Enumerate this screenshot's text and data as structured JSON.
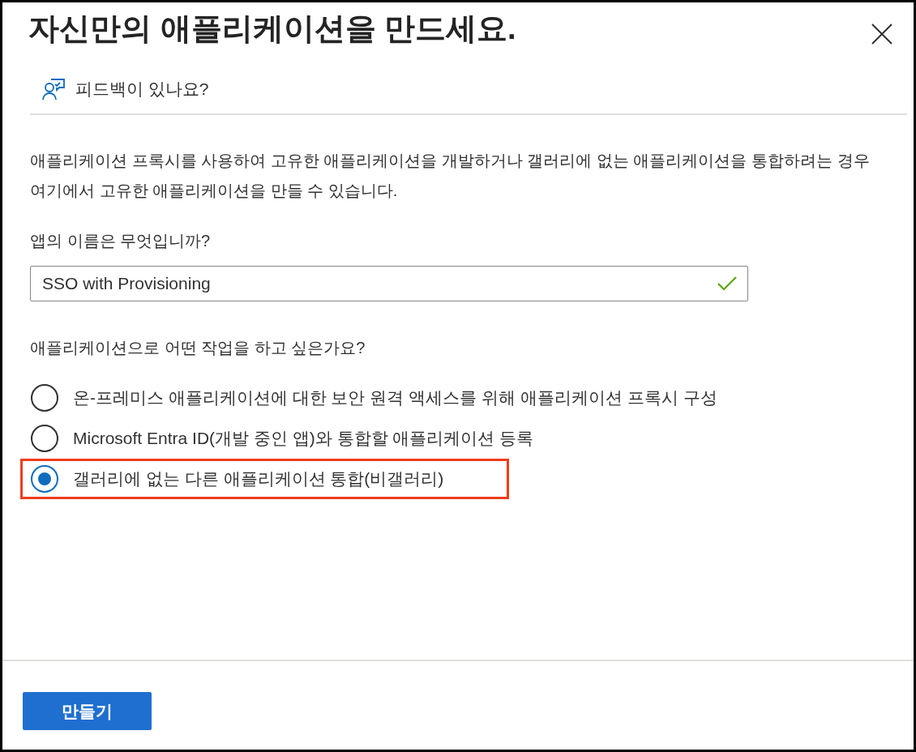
{
  "title": "자신만의 애플리케이션을 만드세요.",
  "feedback": {
    "label": "피드백이 있나요?"
  },
  "description": "애플리케이션 프록시를 사용하여 고유한 애플리케이션을 개발하거나 갤러리에 없는 애플리케이션을 통합하려는 경우 여기에서 고유한 애플리케이션을 만들 수 있습니다.",
  "name_field": {
    "label": "앱의 이름은 무엇입니까?",
    "value": "SSO with Provisioning",
    "valid": true
  },
  "options_label": "애플리케이션으로 어떤 작업을 하고 싶은가요?",
  "options": [
    {
      "label": "온-프레미스 애플리케이션에 대한 보안 원격 액세스를 위해 애플리케이션 프록시 구성",
      "selected": false,
      "highlighted": false
    },
    {
      "label": "Microsoft Entra ID(개발 중인 앱)와 통합할 애플리케이션 등록",
      "selected": false,
      "highlighted": false
    },
    {
      "label": "갤러리에 없는 다른 애플리케이션 통합(비갤러리)",
      "selected": true,
      "highlighted": true
    }
  ],
  "create_button": "만들기"
}
